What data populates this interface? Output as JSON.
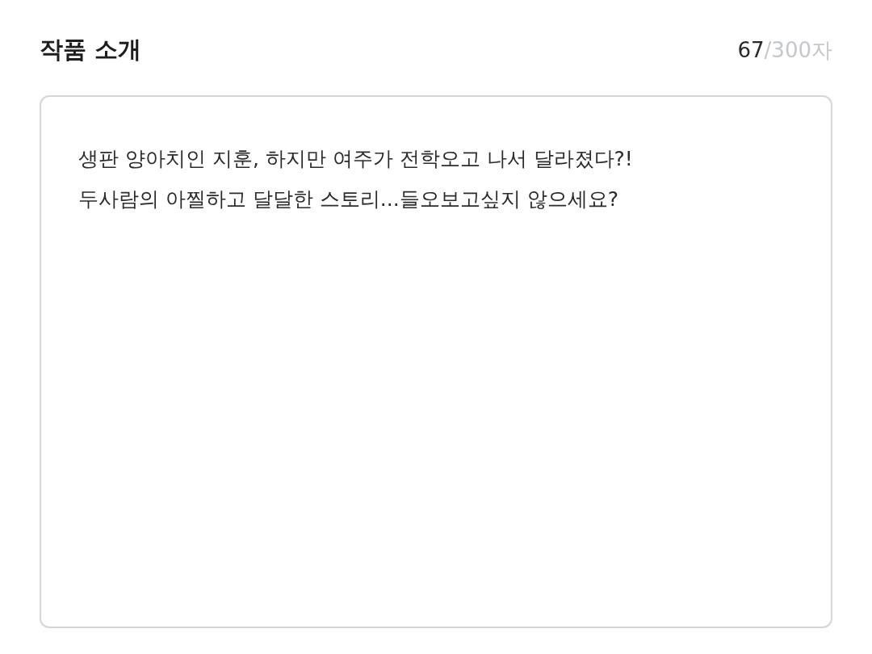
{
  "section": {
    "title": "작품 소개",
    "counter": {
      "count": "67",
      "limit": "/300자"
    }
  },
  "description": {
    "lines": [
      "생판 양아치인 지훈, 하지만 여주가 전학오고 나서 달라졌다?!",
      "두사람의 아찔하고 달달한 스토리...들오보고싶지 않으세요?"
    ]
  }
}
